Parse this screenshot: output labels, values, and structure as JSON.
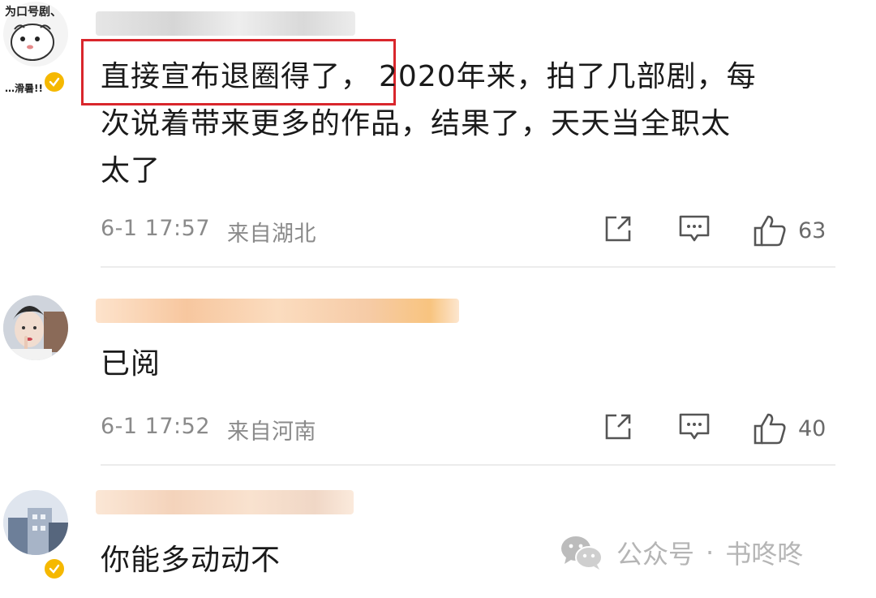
{
  "comments": [
    {
      "text_highlighted": "直接宣布退圈得了，",
      "text_line1_rest": "2020年来，拍了几部剧，每",
      "text_line2": "次说着带来更多的作品，结果了，天天当全职太",
      "text_line3": "太了",
      "avatar_caption_top": "为口号剧、",
      "avatar_caption_bottom": "…滑暑!!",
      "timestamp": "6-1 17:57",
      "location": "来自湖北",
      "likes": "63",
      "verified": true
    },
    {
      "text": "已阅",
      "timestamp": "6-1 17:52",
      "location": "来自河南",
      "likes": "40",
      "verified": false
    },
    {
      "text": "你能多动动不",
      "verified": true
    }
  ],
  "watermark": {
    "label": "公众号",
    "separator": "·",
    "account": "书咚咚"
  },
  "colors": {
    "highlight_border": "#d9262c",
    "verified_badge": "#f5b800",
    "meta_text": "#8a8a8a",
    "divider": "#ececec"
  },
  "icons": [
    "share-icon",
    "comment-icon",
    "thumbs-up-icon",
    "verified-badge-icon",
    "wechat-icon"
  ]
}
